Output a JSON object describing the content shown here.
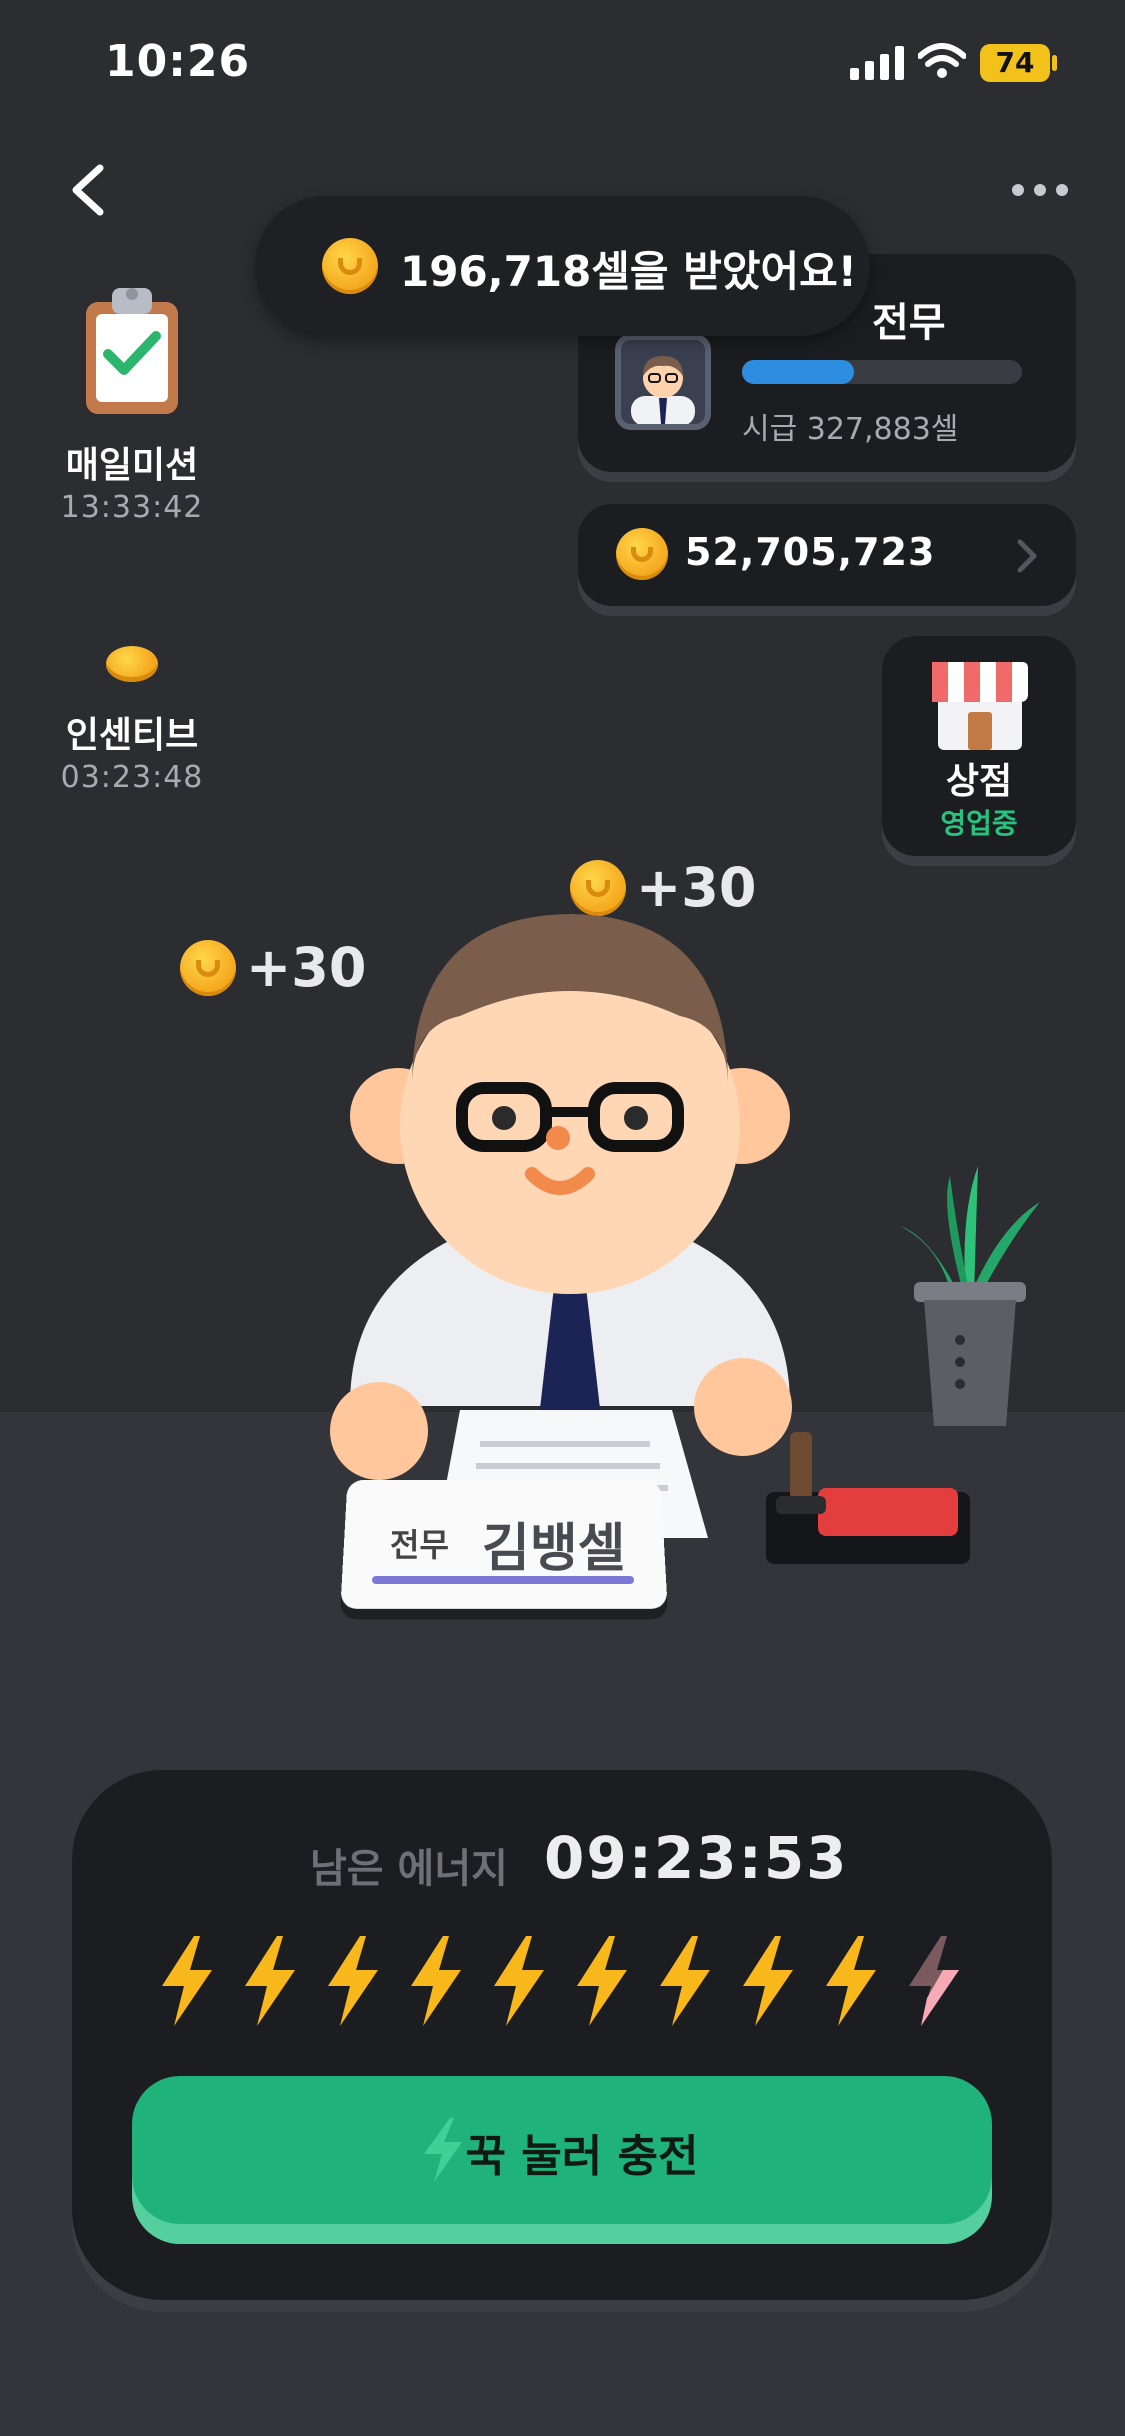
{
  "status_bar": {
    "time": "10:26",
    "battery": "74"
  },
  "toast": {
    "message": "196,718셀을 받았어요!"
  },
  "profile": {
    "rank": "전무",
    "hourly_wage": "시급 327,883셀",
    "progress": 0.4
  },
  "balance": {
    "amount": "52,705,723"
  },
  "store": {
    "label": "상점",
    "status": "영업중"
  },
  "daily_mission": {
    "label": "매일미션",
    "timer": "13:33:42"
  },
  "incentive": {
    "label": "인센티브",
    "timer": "03:23:48"
  },
  "coin_popups": [
    "+30",
    "+30"
  ],
  "name_plate": {
    "rank": "전무",
    "name": "김뱅셀"
  },
  "energy": {
    "label": "남은 에너지",
    "timer": "09:23:53",
    "full_bolts": 9,
    "total_bolts": 10,
    "button_label": "꾹 눌러 충전"
  },
  "colors": {
    "accent_green": "#1fb27a",
    "bolt_yellow": "#f8b81c",
    "progress_blue": "#2d8ee0",
    "store_green": "#29c17e"
  }
}
